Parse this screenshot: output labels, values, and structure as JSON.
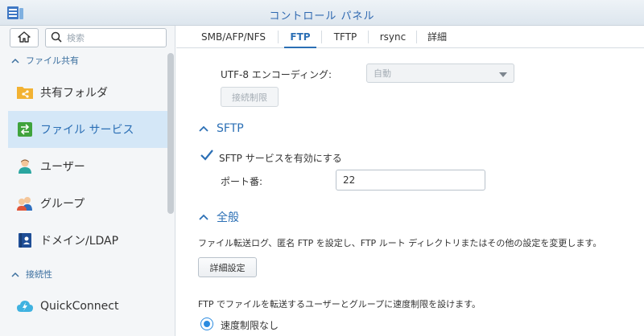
{
  "window": {
    "title": "コントロール パネル"
  },
  "sidebar": {
    "search_placeholder": "検索",
    "groups": [
      {
        "label": "ファイル共有"
      },
      {
        "label": "接続性"
      }
    ],
    "items": [
      {
        "label": "共有フォルダ"
      },
      {
        "label": "ファイル サービス"
      },
      {
        "label": "ユーザー"
      },
      {
        "label": "グループ"
      },
      {
        "label": "ドメイン/LDAP"
      },
      {
        "label": "QuickConnect"
      }
    ]
  },
  "tabs": [
    {
      "label": "SMB/AFP/NFS"
    },
    {
      "label": "FTP"
    },
    {
      "label": "TFTP"
    },
    {
      "label": "rsync"
    },
    {
      "label": "詳細"
    }
  ],
  "content": {
    "encoding_label": "UTF-8 エンコーディング:",
    "encoding_value": "自動",
    "connection_limit_button": "接続制限",
    "sftp": {
      "title": "SFTP",
      "enable_label": "SFTP サービスを有効にする",
      "enabled": true,
      "port_label": "ポート番:",
      "port_value": "22"
    },
    "general": {
      "title": "全般",
      "description": "ファイル転送ログ、匿名 FTP を設定し、FTP ルート ディレクトリまたはその他の設定を変更します。",
      "advanced_button": "詳細設定",
      "speed_description": "FTP でファイルを転送するユーザーとグループに速度制限を設けます。",
      "no_limit_label": "速度制限なし"
    }
  },
  "colors": {
    "accent": "#2b6fb5",
    "active_bg": "#d4e7f7"
  }
}
